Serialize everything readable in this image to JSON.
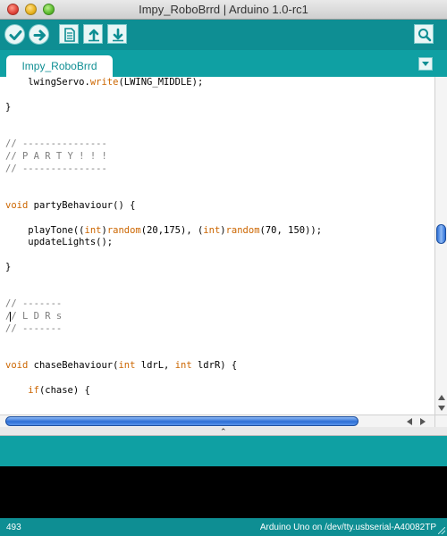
{
  "window": {
    "title": "Impy_RoboBrrd | Arduino 1.0-rc1"
  },
  "toolbar": {
    "buttons": [
      {
        "name": "verify",
        "icon": "checkmark-icon"
      },
      {
        "name": "upload",
        "icon": "arrow-right-icon"
      },
      {
        "name": "new",
        "icon": "new-document-icon"
      },
      {
        "name": "open",
        "icon": "arrow-up-icon"
      },
      {
        "name": "save",
        "icon": "arrow-down-icon"
      },
      {
        "name": "serial-monitor",
        "icon": "magnifier-icon"
      }
    ]
  },
  "tabs": [
    {
      "label": "Impy_RoboBrrd",
      "active": true
    }
  ],
  "editor": {
    "lines": [
      [
        {
          "t": "    lwingServo."
        },
        {
          "t": "write",
          "c": "kw"
        },
        {
          "t": "(LWING_MIDDLE);"
        }
      ],
      [],
      [
        {
          "t": "}"
        }
      ],
      [],
      [],
      [
        {
          "t": "// ---------------",
          "c": "cm"
        }
      ],
      [
        {
          "t": "// P A R T Y ! ! !",
          "c": "cm"
        }
      ],
      [
        {
          "t": "// ---------------",
          "c": "cm"
        }
      ],
      [],
      [],
      [
        {
          "t": "void",
          "c": "kw"
        },
        {
          "t": " partyBehaviour() {"
        }
      ],
      [],
      [
        {
          "t": "    playTone(("
        },
        {
          "t": "int",
          "c": "kw"
        },
        {
          "t": ")"
        },
        {
          "t": "random",
          "c": "kw"
        },
        {
          "t": "(20,175), ("
        },
        {
          "t": "int",
          "c": "kw"
        },
        {
          "t": ")"
        },
        {
          "t": "random",
          "c": "kw"
        },
        {
          "t": "(70, 150));"
        }
      ],
      [
        {
          "t": "    updateLights();"
        }
      ],
      [],
      [
        {
          "t": "}"
        }
      ],
      [],
      [],
      [
        {
          "t": "// -------",
          "c": "cm"
        }
      ],
      [
        {
          "t": "/",
          "c": "cm"
        },
        {
          "cursor": true
        },
        {
          "t": "/ L D R s",
          "c": "cm"
        }
      ],
      [
        {
          "t": "// -------",
          "c": "cm"
        }
      ],
      [],
      [],
      [
        {
          "t": "void",
          "c": "kw"
        },
        {
          "t": " chaseBehaviour("
        },
        {
          "t": "int",
          "c": "kw"
        },
        {
          "t": " ldrL, "
        },
        {
          "t": "int",
          "c": "kw"
        },
        {
          "t": " ldrR) {"
        }
      ],
      [],
      [
        {
          "t": "    "
        },
        {
          "t": "if",
          "c": "kw"
        },
        {
          "t": "(chase) {"
        }
      ]
    ]
  },
  "scroll": {
    "vertical_position": 0.47,
    "horizontal_visible_fraction": 0.82
  },
  "status": {
    "line_number": "493",
    "board": "Arduino Uno on /dev/tty.usbserial-A40082TP"
  },
  "colors": {
    "toolbar": "#0e8e93",
    "accent": "#0fa0a3",
    "keyword": "#cc6600",
    "comment": "#7e7e7e"
  }
}
